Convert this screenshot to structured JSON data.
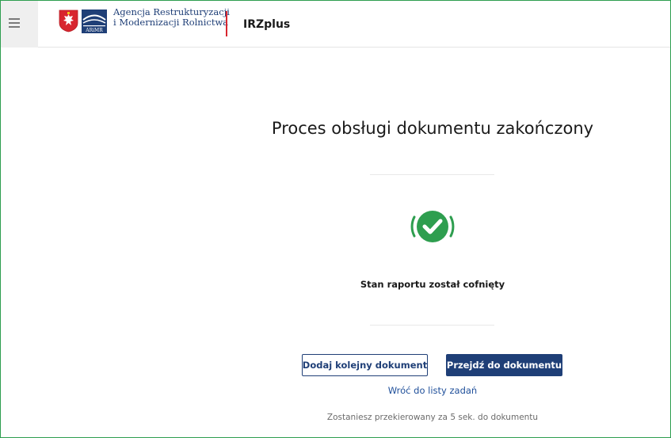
{
  "header": {
    "agency_line1": "Agencja Restrukturyzacji",
    "agency_line2": "i Modernizacji Rolnictwa",
    "arimr_abbr": "ARiMR",
    "app_name": "IRZplus"
  },
  "main": {
    "title": "Proces obsługi dokumentu zakończony",
    "status_message": "Stan raportu został cofnięty",
    "add_document_label": "Dodaj kolejny dokument",
    "go_to_document_label": "Przejdź do dokumentu",
    "back_to_tasks_label": "Wróć do listy zadań",
    "redirect_note": "Zostaniesz przekierowany za 5 sek. do dokumentu"
  },
  "colors": {
    "brand_navy": "#1f3f77",
    "accent_red": "#d8262f",
    "success_green": "#2e9e4f",
    "link_blue": "#1f4f9a"
  },
  "icons": {
    "menu": "hamburger-icon",
    "emblem": "polish-eagle-emblem-icon",
    "agency_logo": "arimr-logo-icon",
    "status": "check-circle-icon"
  }
}
